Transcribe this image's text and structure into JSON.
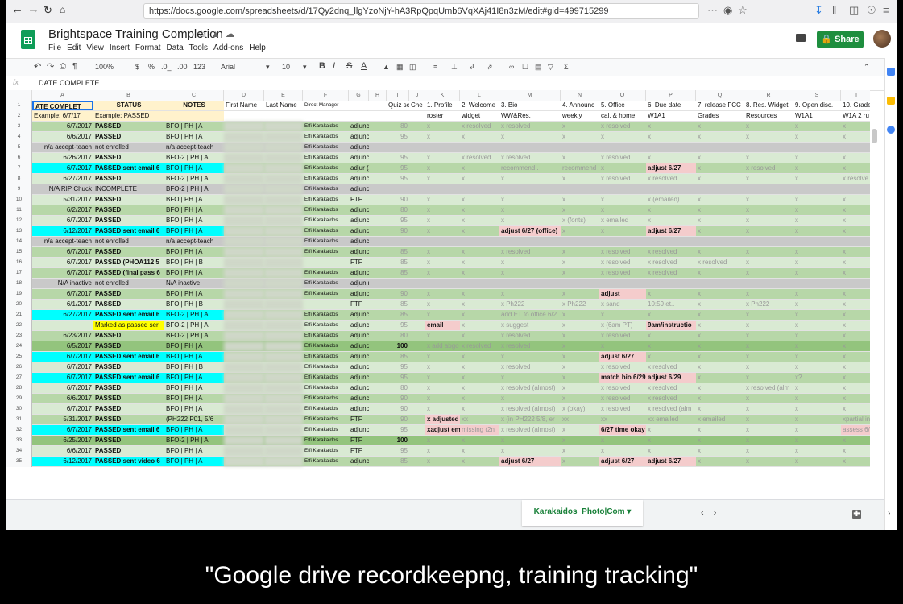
{
  "browser": {
    "url": "https://docs.google.com/spreadsheets/d/17Qy2dnq_llgYzoNjY-hA3RpQpqUmb6VqXAj41I8n3zM/edit#gid=499715299",
    "url_domain": "google.com"
  },
  "doc": {
    "title": "Brightspace Training Completion",
    "menu": [
      "File",
      "Edit",
      "View",
      "Insert",
      "Format",
      "Data",
      "Tools",
      "Add-ons",
      "Help"
    ],
    "share_label": "Share"
  },
  "toolbar": {
    "zoom": "100%",
    "currency": "$",
    "percent": "%",
    "dec_less": ".0_",
    "dec_more": ".00",
    "format": "123",
    "font": "Arial",
    "font_size": "10",
    "bold": "B",
    "italic": "I",
    "strike": "S",
    "color": "A"
  },
  "formula_bar": {
    "fx": "fx",
    "value": "DATE COMPLETE"
  },
  "columns": [
    "A",
    "B",
    "C",
    "D",
    "E",
    "F",
    "G",
    "H",
    "I",
    "J",
    "K",
    "L",
    "M",
    "N",
    "O",
    "P",
    "Q",
    "R",
    "S",
    "T"
  ],
  "header_row": [
    "ATE COMPLET",
    "STATUS",
    "NOTES",
    "First Name",
    "Last Name",
    "Direct Manager",
    "",
    "",
    "Quiz sc",
    "Che",
    "1. Profile",
    "2. Welcome",
    "3. Bio",
    "4. Announc",
    "5. Office",
    "6. Due date",
    "7. release FCC",
    "8. Res. Widget",
    "9. Open disc.",
    "10. Grade"
  ],
  "example_row": [
    "Example: 6/7/17",
    "Example: PASSED",
    "",
    "",
    "",
    "",
    "",
    "",
    "",
    "",
    "roster",
    "widget",
    "WW&Res.",
    "weekly",
    "cal. & home",
    "W1A1",
    "Grades",
    "Resources",
    "W1A1",
    "W1A 2 ru"
  ],
  "rows": [
    {
      "n": "3",
      "date": "6/7/2017",
      "status": "PASSED",
      "notes": "BFO | PH | A",
      "mgr": "Effi Karakaidos",
      "type": "adjunct",
      "quiz": "80",
      "k": "x",
      "l": "x resolved",
      "m": "x resolved",
      "n2": "x",
      "o": "x resolved",
      "p": "x",
      "q": "x",
      "r": "x",
      "s": "x",
      "t": "x"
    },
    {
      "n": "4",
      "date": "6/6/2017",
      "status": "PASSED",
      "notes": "BFO | PH | A",
      "mgr": "Effi Karakaidos",
      "type": "adjunct",
      "quiz": "95",
      "k": "x",
      "l": "x",
      "m": "x",
      "n2": "x",
      "o": "x",
      "p": "x",
      "q": "x",
      "r": "x",
      "s": "x",
      "t": "x"
    },
    {
      "n": "5",
      "date": "n/a accept-teach",
      "status": "not enrolled",
      "notes": "n/a accept-teach",
      "mgr": "Effi Karakaidos",
      "type": "adjunct",
      "quiz": "",
      "k": "",
      "l": "",
      "m": "",
      "n2": "",
      "o": "",
      "p": "",
      "q": "",
      "r": "",
      "s": "",
      "t": ""
    },
    {
      "n": "6",
      "date": "6/26/2017",
      "status": "PASSED",
      "notes": "BFO-2 | PH | A",
      "mgr": "Effi Karakaidos",
      "type": "adjunct",
      "quiz": "95",
      "k": "x",
      "l": "x resolved",
      "m": "x resolved",
      "n2": "x",
      "o": "x resolved",
      "p": "x",
      "q": "x",
      "r": "x",
      "s": "x",
      "t": "x"
    },
    {
      "n": "7",
      "date": "6/7/2017",
      "status": "PASSED sent email 6",
      "notes": "BFO | PH | A",
      "mgr": "Effi Karakaidos",
      "type": "adjur (AiP)",
      "quiz": "95",
      "k": "x",
      "l": "x",
      "m": "recommend..",
      "n2": "recommend",
      "o": "x",
      "p": "adjust 6/27",
      "q": "x",
      "r": "x resolved",
      "s": "x",
      "t": "x"
    },
    {
      "n": "8",
      "date": "6/27/2017",
      "status": "PASSED",
      "notes": "BFO-2 | PH | A",
      "mgr": "Effi Karakaidos",
      "type": "adjunct",
      "quiz": "95",
      "k": "x",
      "l": "x",
      "m": "x",
      "n2": "x",
      "o": "x resolved",
      "p": "x resolved",
      "q": "x",
      "r": "x",
      "s": "x",
      "t": "x resolve"
    },
    {
      "n": "9",
      "date": "N/A RIP Chuck",
      "status": "INCOMPLETE",
      "notes": "BFO-2 | PH | A",
      "mgr": "Effi Karakaidos",
      "type": "adjunct",
      "quiz": "",
      "k": "",
      "l": "",
      "m": "",
      "n2": "",
      "o": "",
      "p": "",
      "q": "",
      "r": "",
      "s": "",
      "t": ""
    },
    {
      "n": "10",
      "date": "5/31/2017",
      "status": "PASSED",
      "notes": "BFO | PH | A",
      "mgr": "Effi Karakaidos",
      "type": "FTF",
      "quiz": "90",
      "k": "x",
      "l": "x",
      "m": "x",
      "n2": "x",
      "o": "x",
      "p": "x (emailed)",
      "q": "x",
      "r": "x",
      "s": "x",
      "t": "x"
    },
    {
      "n": "11",
      "date": "6/2/2017",
      "status": "PASSED",
      "notes": "BFO | PH | A",
      "mgr": "Effi Karakaidos",
      "type": "adjunct",
      "quiz": "80",
      "k": "x",
      "l": "x",
      "m": "x",
      "n2": "x",
      "o": "x",
      "p": "x",
      "q": "x",
      "r": "x",
      "s": "x",
      "t": "x"
    },
    {
      "n": "12",
      "date": "6/7/2017",
      "status": "PASSED",
      "notes": "BFO | PH | A",
      "mgr": "Effi Karakaidos",
      "type": "adjunct",
      "quiz": "95",
      "k": "x",
      "l": "x",
      "m": "x",
      "n2": "x (fonts)",
      "o": "x emailed",
      "p": "x",
      "q": "x",
      "r": "x",
      "s": "x",
      "t": "x"
    },
    {
      "n": "13",
      "date": "6/12/2017",
      "status": "PASSED sent email 6",
      "notes": "BFO | PH | A",
      "mgr": "Effi Karakaidos",
      "type": "adjunct",
      "quiz": "90",
      "k": "x",
      "l": "x",
      "m": "adjust 6/27 (office)",
      "n2": "x",
      "o": "x",
      "p": "adjust 6/27",
      "q": "x",
      "r": "x",
      "s": "x",
      "t": "x"
    },
    {
      "n": "14",
      "date": "n/a accept-teach",
      "status": "not enrolled",
      "notes": "n/a accept-teach",
      "mgr": "Effi Karakaidos",
      "type": "adjunct",
      "quiz": "",
      "k": "",
      "l": "",
      "m": "",
      "n2": "",
      "o": "",
      "p": "",
      "q": "",
      "r": "",
      "s": "",
      "t": ""
    },
    {
      "n": "15",
      "date": "6/7/2017",
      "status": "PASSED",
      "notes": "BFO | PH | A",
      "mgr": "Effi Karakaidos",
      "type": "adjunct",
      "quiz": "85",
      "k": "x",
      "l": "x",
      "m": "x resolved",
      "n2": "x",
      "o": "x resolved",
      "p": "x resolved",
      "q": "x",
      "r": "x",
      "s": "x",
      "t": "x"
    },
    {
      "n": "16",
      "date": "6/7/2017",
      "status": "PASSED (PHOA112 5",
      "notes": "BFO | PH | B",
      "mgr": "",
      "type": "FTF",
      "quiz": "85",
      "k": "x",
      "l": "x",
      "m": "x",
      "n2": "x",
      "o": "x resolved",
      "p": "x resolved",
      "q": "x resolved",
      "r": "x",
      "s": "x",
      "t": "x"
    },
    {
      "n": "17",
      "date": "6/7/2017",
      "status": "PASSED (final pass 6",
      "notes": "BFO | PH | A",
      "mgr": "Effi Karakaidos",
      "type": "adjunct",
      "quiz": "85",
      "k": "x",
      "l": "x",
      "m": "x",
      "n2": "x",
      "o": "x resolved",
      "p": "x resolved",
      "q": "x",
      "r": "x",
      "s": "x",
      "t": "x"
    },
    {
      "n": "18",
      "date": "N/A inactive",
      "status": "not enrolled",
      "notes": "N/A inactive",
      "mgr": "Effi Karakaidos",
      "type": "adjun resig",
      "quiz": "",
      "k": "",
      "l": "",
      "m": "",
      "n2": "",
      "o": "",
      "p": "",
      "q": "",
      "r": "",
      "s": "",
      "t": ""
    },
    {
      "n": "19",
      "date": "6/7/2017",
      "status": "PASSED",
      "notes": "BFO | PH | A",
      "mgr": "Effi Karakaidos",
      "type": "adjunct",
      "quiz": "90",
      "k": "x",
      "l": "x",
      "m": "x",
      "n2": "x",
      "o": "adjust",
      "p": "x",
      "q": "x",
      "r": "x",
      "s": "x",
      "t": "x"
    },
    {
      "n": "20",
      "date": "6/1/2017",
      "status": "PASSED",
      "notes": "BFO | PH | B",
      "mgr": "",
      "type": "FTF",
      "quiz": "85",
      "k": "x",
      "l": "x",
      "m": "x Ph222",
      "n2": "x Ph222",
      "o": "x  sand",
      "p": "10:59  et..",
      "q": "x",
      "r": "x Ph222",
      "s": "x",
      "t": "x"
    },
    {
      "n": "21",
      "date": "6/27/2017",
      "status": "PASSED sent email 6",
      "notes": "BFO-2 | PH | A",
      "mgr": "Effi Karakaidos",
      "type": "adjunct",
      "quiz": "85",
      "k": "x",
      "l": "x",
      "m": "add ET to office 6/2",
      "n2": "x",
      "o": "x",
      "p": "x",
      "q": "x",
      "r": "x",
      "s": "x",
      "t": "x"
    },
    {
      "n": "22",
      "date": "",
      "status": "Marked as passed ser",
      "notes": "BFO-2 | PH | A",
      "mgr": "Effi Karakaidos",
      "type": "adjunct",
      "quiz": "95",
      "k": "email",
      "l": "x",
      "m": "x suggest",
      "n2": "x",
      "o": "x (6am PT)",
      "p": "9am/instructio",
      "q": "x",
      "r": "x",
      "s": "x",
      "t": "x"
    },
    {
      "n": "23",
      "date": "6/23/2017",
      "status": "PASSED",
      "notes": "BFO-2 | PH | A",
      "mgr": "Effi Karakaidos",
      "type": "adjunct",
      "quiz": "80",
      "k": "x",
      "l": "x",
      "m": "x resolved",
      "n2": "x",
      "o": "x resolved",
      "p": "x",
      "q": "x",
      "r": "x",
      "s": "x",
      "t": "x"
    },
    {
      "n": "24",
      "date": "6/5/2017",
      "status": "PASSED",
      "notes": "BFO | PH | A",
      "mgr": "Effi Karakaidos",
      "type": "adjunct",
      "quiz": "100",
      "k": "x add abgo",
      "l": "x resolved",
      "m": "x resolved",
      "n2": "x",
      "o": "x",
      "p": "x",
      "q": "x",
      "r": "x",
      "s": "x",
      "t": "x"
    },
    {
      "n": "25",
      "date": "6/7/2017",
      "status": "PASSED sent email 6",
      "notes": "BFO | PH | A",
      "mgr": "Effi Karakaidos",
      "type": "adjunct",
      "quiz": "85",
      "k": "x",
      "l": "x",
      "m": "x",
      "n2": "x",
      "o": "adjust 6/27",
      "p": "x",
      "q": "x",
      "r": "x",
      "s": "x",
      "t": "x"
    },
    {
      "n": "26",
      "date": "6/7/2017",
      "status": "PASSED",
      "notes": "BFO | PH | B",
      "mgr": "Effi Karakaidos",
      "type": "adjunct",
      "quiz": "95",
      "k": "x",
      "l": "x",
      "m": "x resolved",
      "n2": "x",
      "o": "x resolved",
      "p": "x resolved",
      "q": "x",
      "r": "x",
      "s": "x",
      "t": "x"
    },
    {
      "n": "27",
      "date": "6/7/2017",
      "status": "PASSED sent email 6",
      "notes": "BFO | PH | A",
      "mgr": "Effi Karakaidos",
      "type": "adjunct",
      "quiz": "95",
      "k": "x",
      "l": "x",
      "m": "x",
      "n2": "x",
      "o": "match bio 6/29",
      "p": "adjust 6/29",
      "q": "x",
      "r": "x",
      "s": "x?",
      "t": "x"
    },
    {
      "n": "28",
      "date": "6/7/2017",
      "status": "PASSED",
      "notes": "BFO | PH | A",
      "mgr": "Effi Karakaidos",
      "type": "adjunct",
      "quiz": "80",
      "k": "x",
      "l": "x",
      "m": "x resolved (almost)",
      "n2": "x",
      "o": "x resolved",
      "p": "x resolved",
      "q": "x",
      "r": "x resolved (alm",
      "s": "x",
      "t": "x"
    },
    {
      "n": "29",
      "date": "6/6/2017",
      "status": "PASSED",
      "notes": "BFO | PH | A",
      "mgr": "Effi Karakaidos",
      "type": "adjunct",
      "quiz": "90",
      "k": "x",
      "l": "x",
      "m": "x",
      "n2": "x",
      "o": "x resolved",
      "p": "x resolved",
      "q": "x",
      "r": "x",
      "s": "x",
      "t": "x"
    },
    {
      "n": "30",
      "date": "6/7/2017",
      "status": "PASSED",
      "notes": "BFO | PH | A",
      "mgr": "Effi Karakaidos",
      "type": "adjunct",
      "quiz": "90",
      "k": "x",
      "l": "x",
      "m": "x resolved (almost)",
      "n2": "x (okay)",
      "o": "x resolved",
      "p": "x resolved (alm",
      "q": "x",
      "r": "x",
      "s": "x",
      "t": "x"
    },
    {
      "n": "31",
      "date": "5/31/2017",
      "status": "PASSED",
      "notes": "(PH222 P01, 5/6",
      "mgr": "Effi Karakaidos",
      "type": "FTF",
      "quiz": "90",
      "k": "x adjusted",
      "l": "xx",
      "m": "x (in PH222 5/8, er",
      "n2": "xx",
      "o": "xx",
      "p": "xx emailed",
      "q": "x emailed",
      "r": "x",
      "s": "x",
      "t": "xpartial in"
    },
    {
      "n": "32",
      "date": "6/7/2017",
      "status": "PASSED sent email 6",
      "notes": "BFO | PH | A",
      "mgr": "Effi Karakaidos",
      "type": "adjunct",
      "quiz": "95",
      "k": "xadjust em",
      "l": "missing (2n",
      "m": "x resolved (almost)",
      "n2": "x",
      "o": "6/27 time okay",
      "p": "x",
      "q": "x",
      "r": "x",
      "s": "x",
      "t": "assess 6/"
    },
    {
      "n": "33",
      "date": "6/25/2017",
      "status": "PASSED",
      "notes": "BFO-2 | PH | A",
      "mgr": "Effi Karakaidos",
      "type": "FTF",
      "quiz": "100",
      "k": "x",
      "l": "x",
      "m": "x",
      "n2": "x",
      "o": "x",
      "p": "x",
      "q": "x",
      "r": "x",
      "s": "x",
      "t": "x"
    },
    {
      "n": "34",
      "date": "6/6/2017",
      "status": "PASSED",
      "notes": "BFO | PH | A",
      "mgr": "Effi Karakaidos",
      "type": "FTF",
      "quiz": "95",
      "k": "x",
      "l": "x",
      "m": "x",
      "n2": "x",
      "o": "x",
      "p": "x",
      "q": "x",
      "r": "x",
      "s": "x",
      "t": "x"
    },
    {
      "n": "35",
      "date": "6/12/2017",
      "status": "PASSED sent video 6",
      "notes": "BFO | PH | A",
      "mgr": "Effi Karakaidos",
      "type": "adjunct",
      "quiz": "85",
      "k": "x",
      "l": "x",
      "m": "adjust 6/27",
      "n2": "x",
      "o": "adjust 6/27",
      "p": "adjust 6/27",
      "q": "x",
      "r": "x",
      "s": "x",
      "t": "x"
    }
  ],
  "sheet_tab": "Karakaidos_Photo|Com",
  "caption": "\"Google drive recordkeepng, training tracking\"",
  "colors": {
    "green": "#b7d7a8",
    "light_green": "#d9ead3",
    "cyan": "#00ffff",
    "grey": "#c9c9c9",
    "yellow": "#ffff00",
    "pink": "#f4cccc",
    "header_yellow": "#fff2cc",
    "share": "#1e8e3e"
  }
}
